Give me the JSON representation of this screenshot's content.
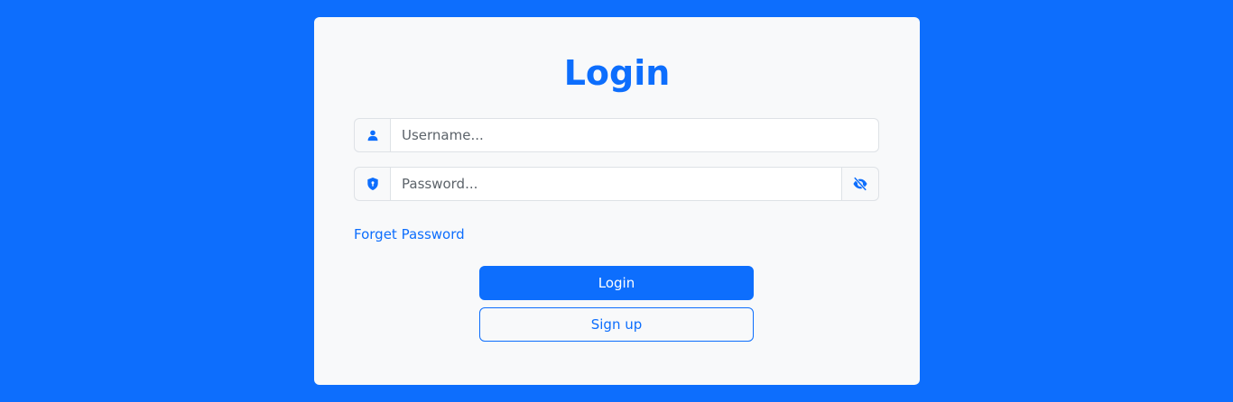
{
  "colors": {
    "page_background": "#0d6efd",
    "card_background": "#f8f9fa",
    "accent": "#0d6efd"
  },
  "login_form": {
    "title": "Login",
    "username": {
      "icon": "user-icon",
      "placeholder": "Username...",
      "value": ""
    },
    "password": {
      "icon": "shield-lock-icon",
      "placeholder": "Password...",
      "value": "",
      "toggle_icon": "eye-slash-icon"
    },
    "forget_password_label": "Forget Password",
    "login_button_label": "Login",
    "signup_button_label": "Sign up"
  }
}
